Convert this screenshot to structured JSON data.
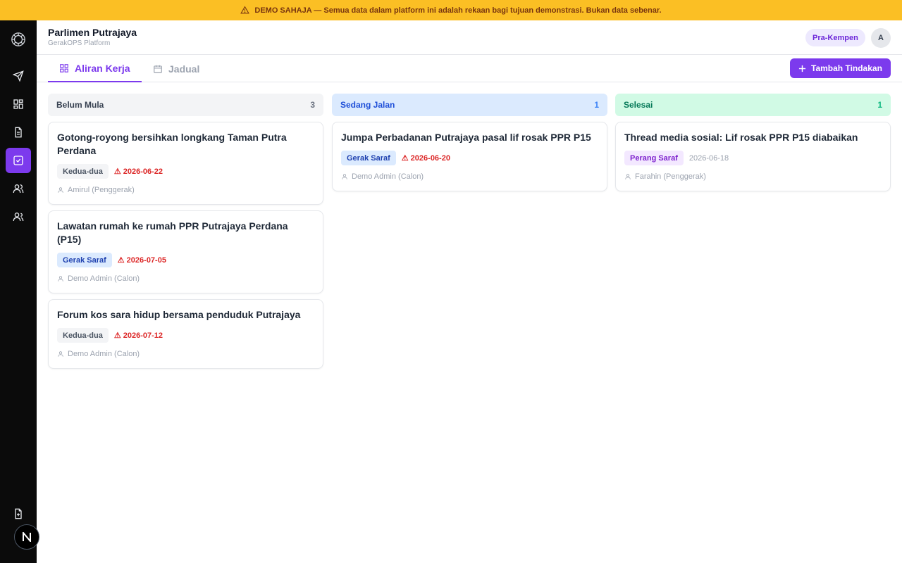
{
  "banner": {
    "text": "DEMO SAHAJA — Semua data dalam platform ini adalah rekaan bagi tujuan demonstrasi. Bukan data sebenar."
  },
  "header": {
    "title": "Parlimen Putrajaya",
    "subtitle": "GerakOPS Platform",
    "phase": "Pra-Kempen",
    "avatar": "A"
  },
  "tabs": [
    {
      "label": "Aliran Kerja",
      "icon": "grid-icon",
      "active": true
    },
    {
      "label": "Jadual",
      "icon": "calendar-icon",
      "active": false
    }
  ],
  "actions": {
    "add_label": "Tambah Tindakan"
  },
  "sidebar": {
    "icons": [
      "logo-icon",
      "send-icon",
      "dashboard-icon",
      "document-icon",
      "tasks-icon",
      "users-icon",
      "team-icon",
      "file-add-icon"
    ],
    "badge": "N"
  },
  "board": {
    "columns": [
      {
        "name": "Belum Mula",
        "count": "3",
        "header_bg": "#f3f4f6",
        "header_color": "#374151",
        "count_color": "#6b7280",
        "cards": [
          {
            "title": "Gotong-royong bersihkan longkang Taman Putra Perdana",
            "tag": "Kedua-dua",
            "date": "⚠ 2026-06-22",
            "owner": "Amirul (Penggerak)"
          },
          {
            "title": "Lawatan rumah ke rumah PPR Putrajaya Perdana (P15)",
            "tag": "Gerak Saraf",
            "date": "⚠ 2026-07-05",
            "owner": "Demo Admin (Calon)"
          },
          {
            "title": "Forum kos sara hidup bersama penduduk Putrajaya",
            "tag": "Kedua-dua",
            "date": "⚠ 2026-07-12",
            "owner": "Demo Admin (Calon)"
          }
        ]
      },
      {
        "name": "Sedang Jalan",
        "count": "1",
        "header_bg": "#dbeafe",
        "header_color": "#1d4ed8",
        "count_color": "#3b82f6",
        "cards": [
          {
            "title": "Jumpa Perbadanan Putrajaya pasal lif rosak PPR P15",
            "tag": "Gerak Saraf",
            "date": "⚠ 2026-06-20",
            "owner": "Demo Admin (Calon)"
          }
        ]
      },
      {
        "name": "Selesai",
        "count": "1",
        "header_bg": "#d1fae5",
        "header_color": "#047857",
        "count_color": "#10b981",
        "cards": [
          {
            "title": "Thread media sosial: Lif rosak PPR P15 diabaikan",
            "tag": "Perang Saraf",
            "date": "2026-06-18",
            "owner": "Farahin (Penggerak)"
          }
        ]
      }
    ]
  },
  "colors": {
    "accent": "#7c3aed",
    "banner": "#fbbf24",
    "overdue": "#dc2626"
  }
}
